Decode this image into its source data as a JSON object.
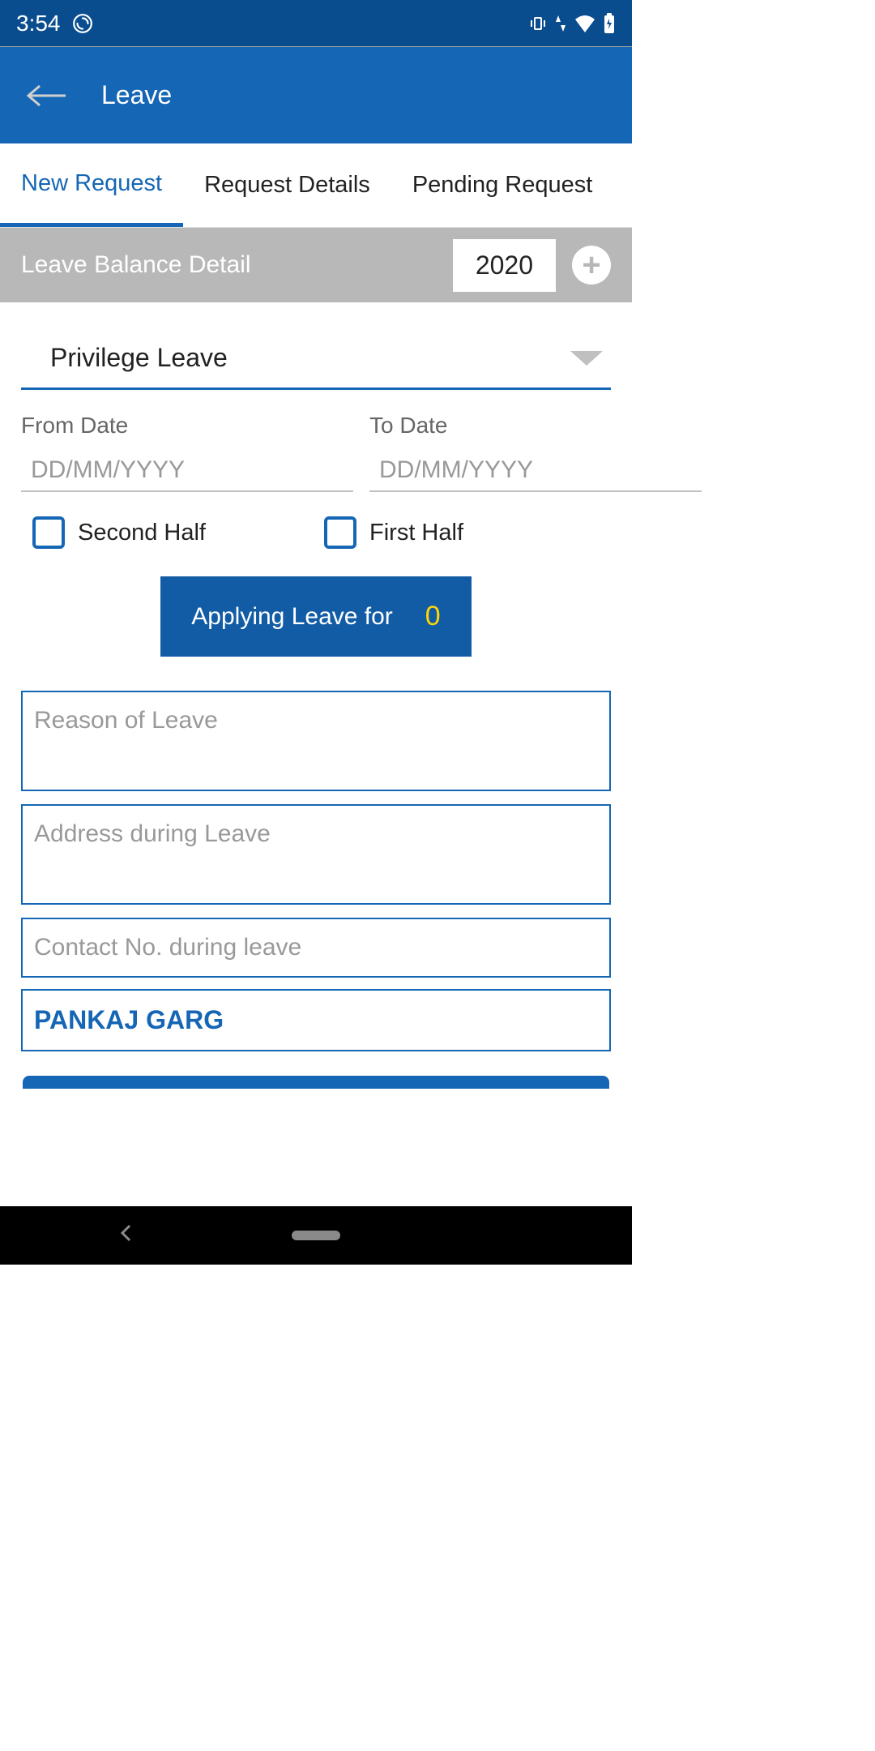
{
  "status": {
    "time": "3:54"
  },
  "header": {
    "title": "Leave"
  },
  "tabs": [
    {
      "label": "New Request",
      "active": true
    },
    {
      "label": "Request Details",
      "active": false
    },
    {
      "label": "Pending Request",
      "active": false
    }
  ],
  "balance": {
    "label": "Leave Balance Detail",
    "year": "2020"
  },
  "form": {
    "leave_type": "Privilege Leave",
    "from_date": {
      "label": "From Date",
      "placeholder": "DD/MM/YYYY",
      "value": ""
    },
    "to_date": {
      "label": "To Date",
      "placeholder": "DD/MM/YYYY",
      "value": ""
    },
    "second_half": {
      "label": "Second Half",
      "checked": false
    },
    "first_half": {
      "label": "First Half",
      "checked": false
    },
    "applying": {
      "label": "Applying Leave for",
      "count": "0"
    },
    "reason": {
      "placeholder": "Reason of Leave",
      "value": ""
    },
    "address": {
      "placeholder": "Address during Leave",
      "value": ""
    },
    "contact": {
      "placeholder": "Contact No. during leave",
      "value": ""
    },
    "name": "PANKAJ GARG"
  }
}
